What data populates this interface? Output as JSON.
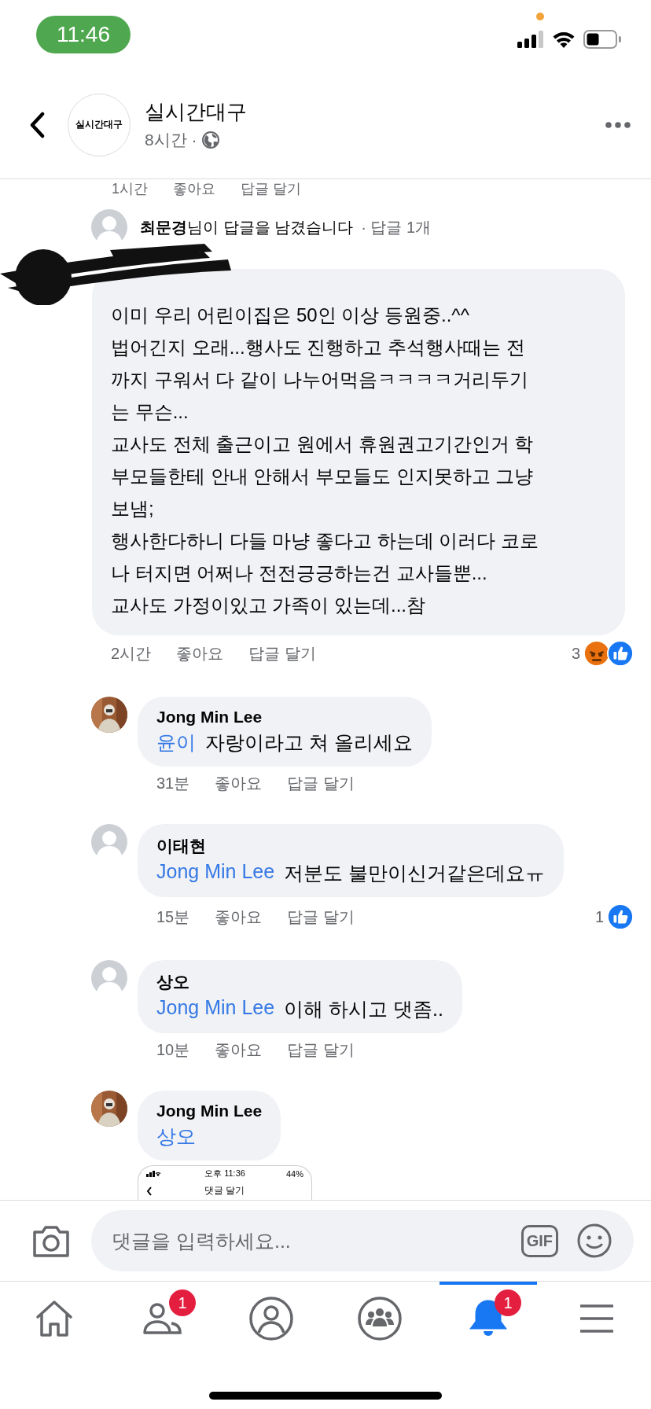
{
  "status_bar": {
    "time": "11:46"
  },
  "header": {
    "page_name": "실시간대구",
    "logo_text": "실시간대구",
    "time": "8시간 ·"
  },
  "partial_meta": {
    "time": "1시간",
    "like": "좋아요",
    "reply": "답글 달기"
  },
  "reply_notice": {
    "text": "**최문경**님이 답글을 남겼습니다",
    "count": "· 답글 1개"
  },
  "main_comment": {
    "lines": [
      "이미 우리 어린이집은 50인 이상 등원중..^^",
      "법어긴지 오래...행사도 진행하고 추석행사때는 전",
      "까지 구워서 다 같이 나누어먹음ㅋㅋㅋㅋ거리두기",
      "는 무슨...",
      "교사도 전체 출근이고 원에서 휴원권고기간인거 학",
      "부모들한테 안내 안해서 부모들도 인지못하고 그냥",
      "보냄;",
      "행사한다하니 다들 마냥 좋다고 하는데 이러다 코로",
      "나 터지면 어쩌나 전전긍긍하는건 교사들뿐...",
      "교사도 가정이있고 가족이 있는데...참"
    ],
    "time": "2시간",
    "like": "좋아요",
    "reply": "답글 달기",
    "reaction_count": "3",
    "reactions": [
      {
        "kind": "angry"
      },
      {
        "kind": "like"
      }
    ]
  },
  "replies": [
    {
      "name": "Jong Min Lee",
      "mention": "윤이",
      "text": "자랑이라고 쳐 올리세요",
      "time": "31분",
      "like": "좋아요",
      "reply": "답글 달기"
    },
    {
      "avatar": {
        "kind": "default"
      },
      "name": "이태현",
      "mention": "Jong Min Lee",
      "text": "저분도 불만이신거같은데요ㅠ",
      "time": "15분",
      "like": "좋아요",
      "reply": "답글 달기",
      "reaction_count": "1",
      "reactions": [
        {
          "kind": "like"
        }
      ]
    },
    {
      "avatar": {
        "kind": "default"
      },
      "name": "상오",
      "mention": "Jong Min Lee",
      "text": "이해 하시고 댓좀..",
      "time": "10분",
      "like": "좋아요",
      "reply": "답글 달기"
    },
    {
      "name": "Jong Min Lee",
      "mention": "상오",
      "attachment": {
        "time": "오후 11:36",
        "battery": "44%",
        "title": "댓글 달기"
      }
    }
  ],
  "composer": {
    "placeholder": "댓글을 입력하세요...",
    "gif_label": "GIF"
  },
  "tabs": [
    {
      "kind": "home",
      "selected": false
    },
    {
      "kind": "friends",
      "selected": false,
      "badge": "1"
    },
    {
      "kind": "profile",
      "selected": false
    },
    {
      "kind": "groups",
      "selected": false
    },
    {
      "kind": "notifications",
      "selected": true,
      "badge": "1"
    },
    {
      "kind": "menu",
      "selected": false
    }
  ]
}
